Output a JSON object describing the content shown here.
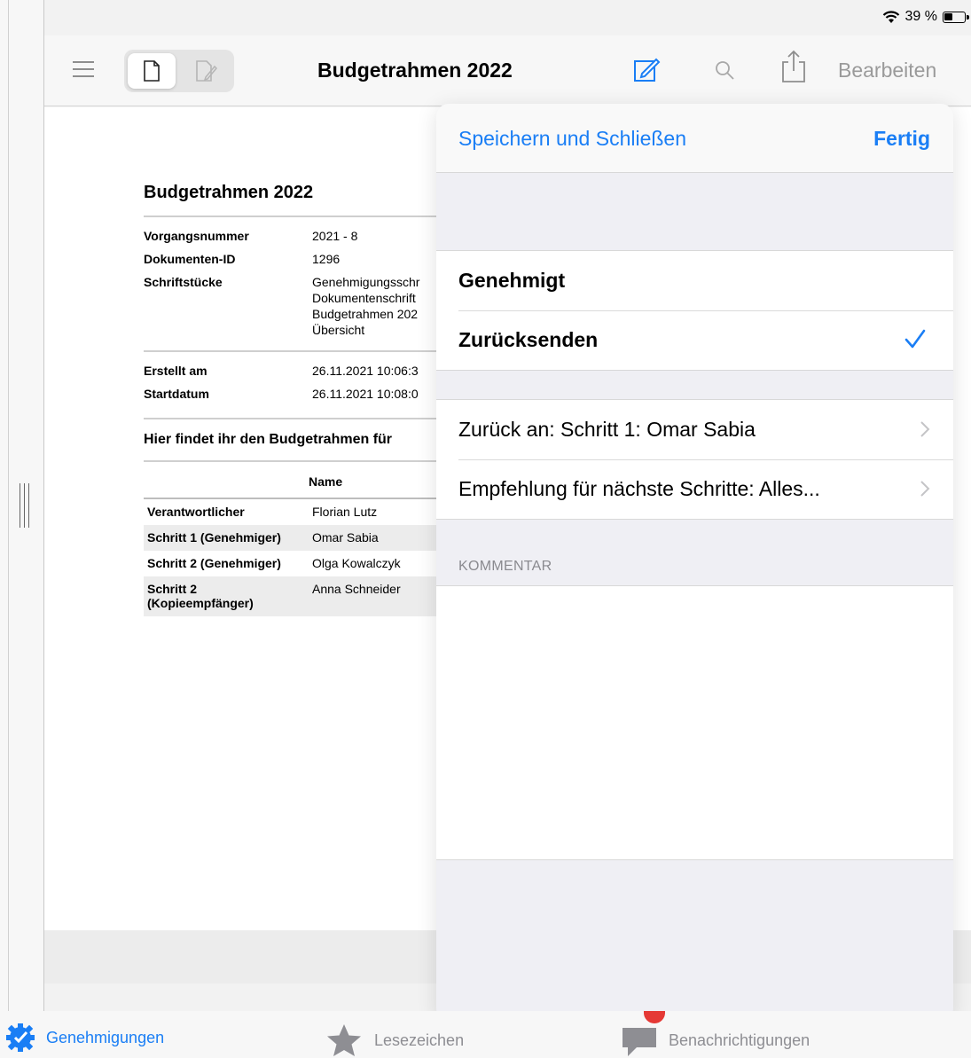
{
  "status_bar": {
    "battery_percent": "39 %"
  },
  "navbar": {
    "title": "Budgetrahmen 2022",
    "edit_label": "Bearbeiten"
  },
  "document": {
    "title": "Budgetrahmen 2022",
    "meta": [
      {
        "key": "Vorgangsnummer",
        "value": "2021 - 8"
      },
      {
        "key": "Dokumenten-ID",
        "value": "1296"
      },
      {
        "key": "Schriftstücke",
        "value": "Genehmigungsschr"
      }
    ],
    "schriftstuecke_more": [
      "Dokumentenschrift",
      "Budgetrahmen 202",
      "Übersicht"
    ],
    "dates": [
      {
        "key": "Erstellt am",
        "value": "26.11.2021 10:06:3"
      },
      {
        "key": "Startdatum",
        "value": "26.11.2021 10:08:0"
      }
    ],
    "heading": "Hier findet ihr den Budgetrahmen für",
    "table": {
      "header_name": "Name",
      "rows": [
        {
          "role": "Verantwortlicher",
          "name": "Florian Lutz"
        },
        {
          "role": "Schritt 1 (Genehmiger)",
          "name": "Omar Sabia"
        },
        {
          "role": "Schritt 2 (Genehmiger)",
          "name": "Olga Kowalczyk"
        },
        {
          "role_line1": "Schritt 2",
          "role_line2": "(Kopieempfänger)",
          "name": "Anna Schneider"
        }
      ]
    }
  },
  "popover": {
    "save_close": "Speichern und Schließen",
    "done": "Fertig",
    "options": [
      {
        "label": "Genehmigt",
        "selected": false
      },
      {
        "label": "Zurücksenden",
        "selected": true
      }
    ],
    "return_to": "Zurück an: Schritt 1: Omar Sabia",
    "recommendation": "Empfehlung für nächste Schritte: Alles...",
    "comment_section": "KOMMENTAR",
    "comment_value": ""
  },
  "tabbar": {
    "approvals": "Genehmigungen",
    "bookmarks": "Lesezeichen",
    "notifications": "Benachrichtigungen"
  },
  "colors": {
    "accent": "#1a7ef5",
    "badge": "#e53935"
  }
}
